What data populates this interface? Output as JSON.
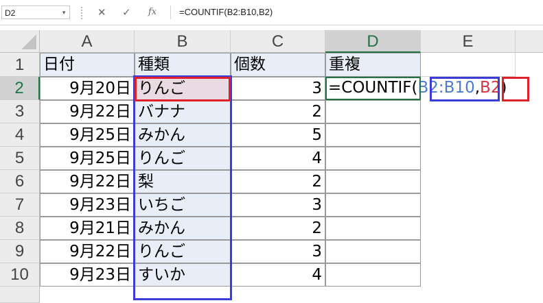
{
  "name_box": "D2",
  "formula_bar": {
    "cancel_icon": "✕",
    "enter_icon": "✓",
    "fx_label": "fx",
    "formula": "=COUNTIF(B2:B10,B2)"
  },
  "columns": [
    "A",
    "B",
    "C",
    "D",
    "E"
  ],
  "rows": [
    "1",
    "2",
    "3",
    "4",
    "5",
    "6",
    "7",
    "8",
    "9",
    "10"
  ],
  "header": {
    "a": "日付",
    "b": "種類",
    "c": "個数",
    "d": "重複"
  },
  "data": [
    {
      "date": "9月20日",
      "kind": "りんご",
      "count": "3"
    },
    {
      "date": "9月22日",
      "kind": "バナナ",
      "count": "2"
    },
    {
      "date": "9月25日",
      "kind": "みかん",
      "count": "5"
    },
    {
      "date": "9月25日",
      "kind": "りんご",
      "count": "4"
    },
    {
      "date": "9月22日",
      "kind": "梨",
      "count": "2"
    },
    {
      "date": "9月23日",
      "kind": "いちご",
      "count": "3"
    },
    {
      "date": "9月21日",
      "kind": "みかん",
      "count": "2"
    },
    {
      "date": "9月22日",
      "kind": "りんご",
      "count": "3"
    },
    {
      "date": "9月23日",
      "kind": "すいか",
      "count": "4"
    }
  ],
  "edit_cell": {
    "prefix": "=COUNTIF(",
    "range_ref": "B2:B10",
    "comma": ",",
    "crit_ref": "B2",
    "suffix": ")"
  },
  "colors": {
    "range_highlight": "#3b3bd6",
    "criteria_highlight": "#e0202a",
    "selection": "#217346"
  }
}
